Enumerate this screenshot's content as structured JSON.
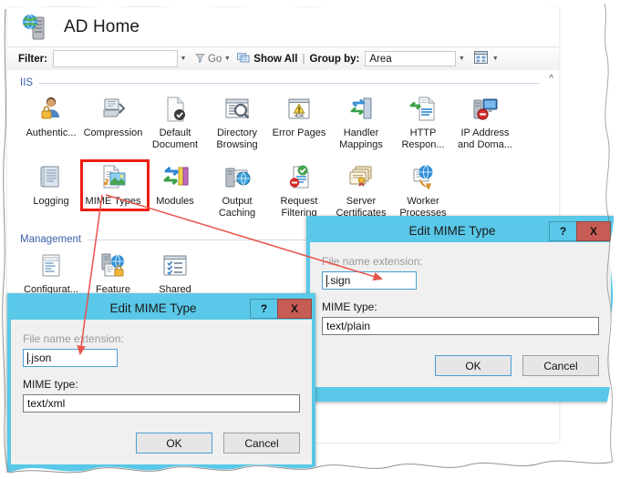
{
  "window": {
    "title": "AD Home",
    "title_icon": "server-globe-icon"
  },
  "filter_bar": {
    "filter_label": "Filter:",
    "filter_value": "",
    "filter_placeholder": "",
    "go_label": "Go",
    "go_icon": "funnel-icon",
    "show_all_label": "Show All",
    "show_all_icon": "show-all-icon",
    "separator": "|",
    "group_by_label": "Group by:",
    "group_by_value": "Area",
    "view_icon": "view-mode-icon"
  },
  "content": {
    "scroll_indicator": "^",
    "groups": [
      {
        "name": "IIS",
        "items": [
          {
            "label": "Authentic...",
            "icon": "authentication-icon",
            "selected": false
          },
          {
            "label": "Compression",
            "icon": "compression-icon",
            "selected": false
          },
          {
            "label": "Default Document",
            "icon": "default-document-icon",
            "selected": false
          },
          {
            "label": "Directory Browsing",
            "icon": "directory-browsing-icon",
            "selected": false
          },
          {
            "label": "Error Pages",
            "icon": "error-pages-icon",
            "selected": false
          },
          {
            "label": "Handler Mappings",
            "icon": "handler-mappings-icon",
            "selected": false
          },
          {
            "label": "HTTP Respon...",
            "icon": "http-response-headers-icon",
            "selected": false
          },
          {
            "label": "IP Address and Doma...",
            "icon": "ip-address-restrictions-icon",
            "selected": false
          },
          {
            "label": "Logging",
            "icon": "logging-icon",
            "selected": false
          },
          {
            "label": "MIME Types",
            "icon": "mime-types-icon",
            "selected": true
          },
          {
            "label": "Modules",
            "icon": "modules-icon",
            "selected": false
          },
          {
            "label": "Output Caching",
            "icon": "output-caching-icon",
            "selected": false
          },
          {
            "label": "Request Filtering",
            "icon": "request-filtering-icon",
            "selected": false
          },
          {
            "label": "Server Certificates",
            "icon": "server-certificates-icon",
            "selected": false
          },
          {
            "label": "Worker Processes",
            "icon": "worker-processes-icon",
            "selected": false
          }
        ]
      },
      {
        "name": "Management",
        "items": [
          {
            "label": "Configurat... Editor",
            "icon": "configuration-editor-icon",
            "selected": false
          },
          {
            "label": "Feature Delegation",
            "icon": "feature-delegation-icon",
            "selected": false
          },
          {
            "label": "Shared Configurat...",
            "icon": "shared-configuration-icon",
            "selected": false
          }
        ]
      }
    ]
  },
  "dialog_top": {
    "title": "Edit MIME Type",
    "help_label": "?",
    "close_label": "X",
    "extension_label": "File name extension:",
    "extension_value": ".sign",
    "mime_label": "MIME type:",
    "mime_value": "text/plain",
    "ok_label": "OK",
    "cancel_label": "Cancel"
  },
  "dialog_bottom": {
    "title": "Edit MIME Type",
    "help_label": "?",
    "close_label": "X",
    "extension_label": "File name extension:",
    "extension_value": ".json",
    "mime_label": "MIME type:",
    "mime_value": "text/xml",
    "ok_label": "OK",
    "cancel_label": "Cancel"
  },
  "annotations": {
    "highlight_color": "#ee1c11",
    "arrow_color": "#e8534a",
    "title_bar_color": "#5ac8e8",
    "close_button_color": "#c75c55"
  }
}
